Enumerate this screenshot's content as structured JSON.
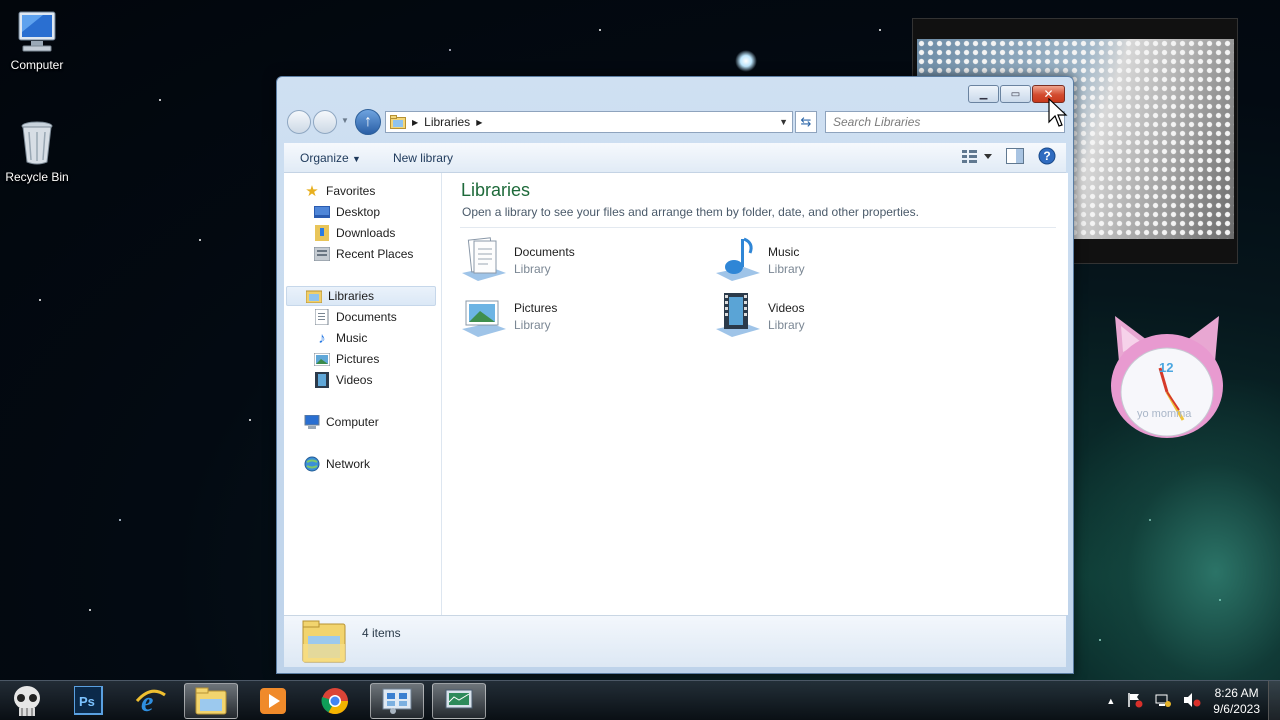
{
  "desktop": {
    "icons": [
      {
        "label": "Computer"
      },
      {
        "label": "Recycle Bin"
      }
    ]
  },
  "window": {
    "address": {
      "crumb": "Libraries"
    },
    "search_placeholder": "Search Libraries",
    "toolbar": {
      "organize": "Organize",
      "new_library": "New library"
    },
    "nav": {
      "favorites": "Favorites",
      "desktop": "Desktop",
      "downloads": "Downloads",
      "recent": "Recent Places",
      "libraries": "Libraries",
      "documents": "Documents",
      "music": "Music",
      "pictures": "Pictures",
      "videos": "Videos",
      "computer": "Computer",
      "network": "Network"
    },
    "content": {
      "title": "Libraries",
      "description": "Open a library to see your files and arrange them by folder, date, and other properties.",
      "items": [
        {
          "name": "Documents",
          "type": "Library"
        },
        {
          "name": "Music",
          "type": "Library"
        },
        {
          "name": "Pictures",
          "type": "Library"
        },
        {
          "name": "Videos",
          "type": "Library"
        }
      ]
    },
    "details": {
      "count": "4 items"
    }
  },
  "gadgets": {
    "clock_label": "yo momma",
    "clock_number": "12"
  },
  "taskbar": {
    "time": "8:26 AM",
    "date": "9/6/2023"
  },
  "colors": {
    "title_green": "#1e6a3a",
    "close_red": "#d24b2f",
    "accent_blue": "#2a5fa6"
  }
}
